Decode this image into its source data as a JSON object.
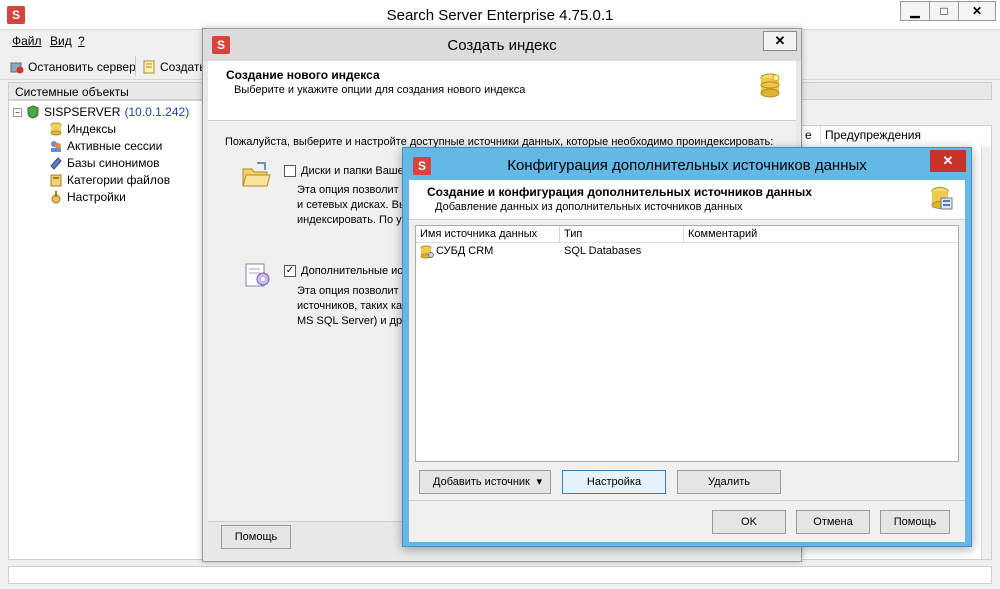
{
  "main_window": {
    "app_icon_letter": "S",
    "title": "Search Server Enterprise 4.75.0.1",
    "controls": {
      "minimize": "▁",
      "maximize": "□",
      "close": "✕"
    },
    "menu": [
      "Файл",
      "Вид",
      "?"
    ],
    "toolbar": {
      "stop_server": "Остановить сервер",
      "create": "Создать"
    },
    "left_panel_header": "Системные объекты",
    "tree": {
      "server_name": "SISPSERVER",
      "server_ip": "(10.0.1.242)",
      "expander": "−",
      "children": [
        "Индексы",
        "Активные сессии",
        "Базы синонимов",
        "Категории файлов",
        "Настройки"
      ]
    },
    "right_columns": [
      "е",
      "Предупреждения"
    ]
  },
  "create_index_dialog": {
    "app_icon_letter": "S",
    "title": "Создать индекс",
    "close": "✕",
    "header_title": "Создание нового индекса",
    "header_subtitle": "Выберите и укажите опции для создания нового индекса",
    "instruction": "Пожалуйста, выберите и настройте доступные источники данных, которые необходимо проиндексировать:",
    "option_disks": {
      "checked": false,
      "label": "Диски и папки Вашего компьютера",
      "desc_lines": [
        "Эта опция позволит Ва",
        "и сетевых дисках. Вы",
        "индексировать. По ум"
      ]
    },
    "option_additional": {
      "checked": true,
      "check_glyph": "✓",
      "label": "Дополнительные исто",
      "desc_lines": [
        "Эта опция позволит Ва",
        "источников, таких как",
        "MS SQL Server) и друг"
      ]
    },
    "help_button": "Помощь"
  },
  "config_sources_dialog": {
    "app_icon_letter": "S",
    "title": "Конфигурация дополнительных источников данных",
    "close": "✕",
    "header_title": "Создание и конфигурация дополнительных источников данных",
    "header_subtitle": "Добавление данных из дополнительных источников данных",
    "columns": [
      "Имя источника данных",
      "Тип",
      "Комментарий"
    ],
    "rows": [
      {
        "name": "СУБД CRM",
        "type": "SQL Databases",
        "comment": ""
      }
    ],
    "add_source_button": "Добавить источник",
    "dropdown_arrow": "▾",
    "configure_button": "Настройка",
    "delete_button": "Удалить",
    "ok_button": "OK",
    "cancel_button": "Отмена",
    "help_button": "Помощь"
  }
}
